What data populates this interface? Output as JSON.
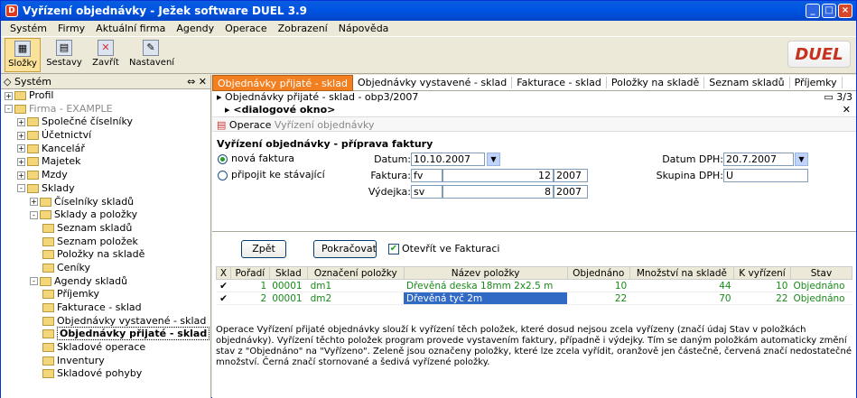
{
  "window": {
    "title": "Vyřízení objednávky - Ježek software DUEL 3.9",
    "app_icon": "D"
  },
  "menu": [
    "Systém",
    "Firmy",
    "Aktuální firma",
    "Agendy",
    "Operace",
    "Zobrazení",
    "Nápověda"
  ],
  "toolbar": {
    "items": [
      "Složky",
      "Sestavy",
      "Zavřít",
      "Nastavení"
    ],
    "logo": "DUEL"
  },
  "sidebar": {
    "title": "Systém",
    "tree": [
      {
        "label": "Profil",
        "indent": 0,
        "pm": "+"
      },
      {
        "label": "Firma - EXAMPLE",
        "indent": 0,
        "pm": "-",
        "gray": true
      },
      {
        "label": "Společné číselníky",
        "indent": 1,
        "pm": "+"
      },
      {
        "label": "Účetnictví",
        "indent": 1,
        "pm": "+"
      },
      {
        "label": "Kancelář",
        "indent": 1,
        "pm": "+"
      },
      {
        "label": "Majetek",
        "indent": 1,
        "pm": "+"
      },
      {
        "label": "Mzdy",
        "indent": 1,
        "pm": "+"
      },
      {
        "label": "Sklady",
        "indent": 1,
        "pm": "-"
      },
      {
        "label": "Číselníky skladů",
        "indent": 2,
        "pm": "+"
      },
      {
        "label": "Sklady a položky",
        "indent": 2,
        "pm": "-"
      },
      {
        "label": "Seznam skladů",
        "indent": 3,
        "pm": ""
      },
      {
        "label": "Seznam položek",
        "indent": 3,
        "pm": ""
      },
      {
        "label": "Položky na skladě",
        "indent": 3,
        "pm": ""
      },
      {
        "label": "Ceníky",
        "indent": 3,
        "pm": ""
      },
      {
        "label": "Agendy skladů",
        "indent": 2,
        "pm": "-"
      },
      {
        "label": "Příjemky",
        "indent": 3,
        "pm": ""
      },
      {
        "label": "Fakturace - sklad",
        "indent": 3,
        "pm": ""
      },
      {
        "label": "Objednávky vystavené - sklad",
        "indent": 3,
        "pm": ""
      },
      {
        "label": "Objednávky přijaté - sklad",
        "indent": 3,
        "pm": "",
        "selected": true
      },
      {
        "label": "Skladové operace",
        "indent": 3,
        "pm": ""
      },
      {
        "label": "Inventury",
        "indent": 3,
        "pm": ""
      },
      {
        "label": "Skladové pohyby",
        "indent": 3,
        "pm": ""
      }
    ]
  },
  "tabs": [
    "Objednávky přijaté - sklad",
    "Objednávky vystavené - sklad",
    "Fakturace - sklad",
    "Položky na skladě",
    "Seznam skladů",
    "Příjemky"
  ],
  "breadcrumb": {
    "line1": "Objednávky přijaté - sklad - obp3/2007",
    "line2": "<dialogové okno>",
    "pager": "3/3"
  },
  "operation": {
    "label": "Operace",
    "value": "Vyřízení objednávky"
  },
  "form": {
    "title": "Vyřízení objednávky - příprava faktury",
    "radio1": "nová faktura",
    "radio2": "připojit ke stávající",
    "datum_label": "Datum:",
    "datum": "10.10.2007",
    "faktura_label": "Faktura:",
    "faktura_prefix": "fv",
    "faktura_num": "12",
    "faktura_year": "2007",
    "vydejka_label": "Výdejka:",
    "vydejka_prefix": "sv",
    "vydejka_num": "8",
    "vydejka_year": "2007",
    "datum_dph_label": "Datum DPH:",
    "datum_dph": "20.7.2007",
    "skupina_label": "Skupina DPH:",
    "skupina": "U"
  },
  "buttons": {
    "back": "Zpět",
    "next": "Pokračovat",
    "open_check": "Otevřít ve Fakturaci"
  },
  "table": {
    "headers": [
      "X",
      "Pořadí",
      "Sklad",
      "Označení položky",
      "Název položky",
      "Objednáno",
      "Množství na skladě",
      "K vyřízení",
      "Stav"
    ],
    "rows": [
      [
        "✔",
        "1",
        "00001",
        "dm1",
        "Dřevěná deska 18mm 2x2.5 m",
        "10",
        "44",
        "10",
        "Objednáno"
      ],
      [
        "✔",
        "2",
        "00001",
        "dm2",
        "Dřevěná tyč 2m",
        "22",
        "70",
        "22",
        "Objednáno"
      ]
    ]
  },
  "note": "Operace Vyřízení přijaté objednávky slouží k vyřízení těch položek, které dosud nejsou zcela vyřízeny (značí údaj Stav v položkách objednávky). Vyřízení těchto položek program provede vystavením faktury, případně i výdejky. Tím se daným položkám automaticky změní stav z \"Objednáno\" na \"Vyřízeno\". Zeleně jsou označeny položky, které lze zcela vyřídit, oranžově jen částečně, červená značí nedostatečné množství. Černá značí stornované a šedivá vyřízené položky."
}
